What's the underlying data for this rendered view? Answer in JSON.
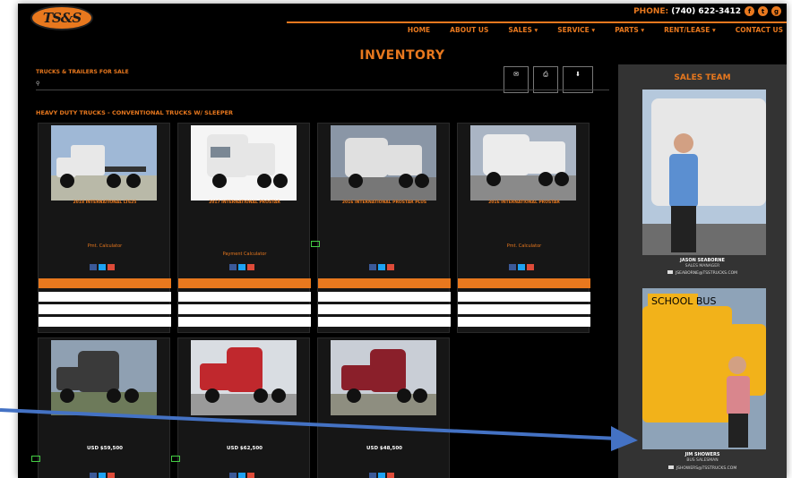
{
  "site": {
    "logo_text": "TS&S",
    "phone_label": "PHONE:",
    "phone": "(740) 622-3412",
    "social_icons": [
      "facebook-icon",
      "twitter-icon",
      "google-plus-icon"
    ],
    "social_glyphs": [
      "f",
      "t",
      "g"
    ],
    "accent_color": "#e8781e",
    "background_color": "#000000"
  },
  "nav": {
    "items": [
      "HOME",
      "ABOUT US",
      "SALES ▾",
      "SERVICE ▾",
      "PARTS ▾",
      "RENT/LEASE ▾",
      "CONTACT US"
    ]
  },
  "page": {
    "title": "INVENTORY",
    "list_heading": "TRUCKS & TRAILERS FOR SALE",
    "search_icon_glyph": "⚲",
    "category_heading": "HEAVY DUTY TRUCKS - CONVENTIONAL TRUCKS W/ SLEEPER"
  },
  "tools": {
    "email_icon": "✉",
    "print_icon": "⎙",
    "download_icon": "⬇"
  },
  "listings": [
    {
      "title": "2018 INTERNATIONAL LT625",
      "price": "",
      "calc": "Pmt. Calculator",
      "note": "",
      "image_colors": [
        "#9fb8d6",
        "#e8e8e8",
        "#6a6a6a"
      ]
    },
    {
      "title": "2017 INTERNATIONAL PROSTAR",
      "price": "",
      "calc": "Payment Calculator",
      "note": "",
      "image_colors": [
        "#f5f5f5",
        "#e6e6e6",
        "#5a5a5a"
      ]
    },
    {
      "title": "2016 INTERNATIONAL PROSTAR PLUS",
      "price": "",
      "calc": "",
      "note": "",
      "image_colors": [
        "#8a96a6",
        "#e0e0e0",
        "#4a4a4a"
      ]
    },
    {
      "title": "2016 INTERNATIONAL PROSTAR",
      "price": "",
      "calc": "Pmt. Calculator",
      "note": "",
      "image_colors": [
        "#aab5c4",
        "#ececec",
        "#555555"
      ]
    },
    {
      "title": "",
      "price": "USD $59,500",
      "calc": "",
      "note": "",
      "image_colors": [
        "#8fa0b2",
        "#3a3a3a",
        "#4d4d4d"
      ]
    },
    {
      "title": "",
      "price": "USD $62,500",
      "calc": "",
      "note": "",
      "image_colors": [
        "#d9dde2",
        "#c0282d",
        "#555555"
      ]
    },
    {
      "title": "",
      "price": "USD $48,500",
      "calc": "",
      "note": "",
      "image_colors": [
        "#c9ced6",
        "#8a1f2a",
        "#555555"
      ]
    }
  ],
  "sidebar": {
    "title": "SALES TEAM",
    "members": [
      {
        "name": "JASON SEABORNE",
        "role": "SALES MANAGER",
        "email": "JSEABORNE@TSSTRUCKS.COM",
        "photo_colors": [
          "#b5c8dc",
          "#e7e7e7",
          "#5b8fd1"
        ]
      },
      {
        "name": "JIM SHOWERS",
        "role": "BUS SALESMAN",
        "email": "JSHOWERS@TSSTRUCKS.COM",
        "photo_colors": [
          "#8ea3b8",
          "#f2b21a",
          "#d9868d"
        ]
      }
    ]
  },
  "annotation": {
    "arrow_color": "#4472c4"
  }
}
